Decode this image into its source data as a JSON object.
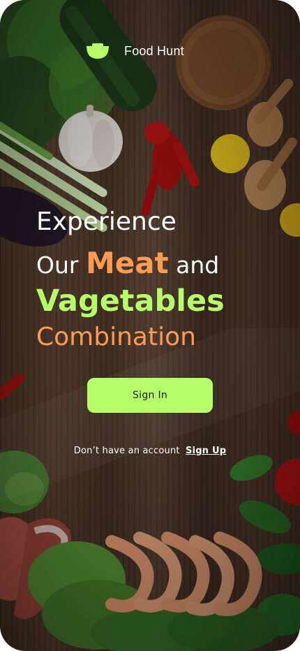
{
  "app": {
    "brand_name": "Food Hunt",
    "logo_icon": "bowl-icon"
  },
  "headline": {
    "line1": "Experience",
    "line2_prefix": "Our",
    "line2_accent": "Meat",
    "line2_suffix": "and",
    "line3": "Vagetables",
    "line4": "Combination"
  },
  "actions": {
    "signin_label": "Sign In",
    "account_prompt": "Don’t have an account",
    "signup_label": "Sign Up"
  },
  "colors": {
    "accent_green": "#b6ff6a",
    "accent_orange": "#ff9b53",
    "text": "#ffffff"
  }
}
